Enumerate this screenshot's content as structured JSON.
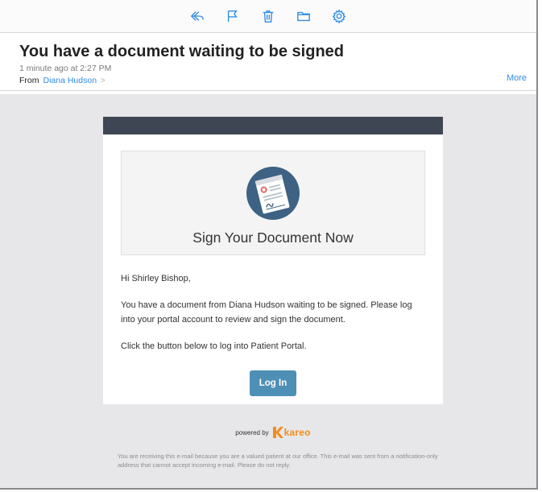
{
  "toolbar": {
    "icons": [
      "reply-icon",
      "flag-icon",
      "trash-icon",
      "folder-icon",
      "gear-icon"
    ]
  },
  "header": {
    "subject": "You have a document waiting to be signed",
    "time": "1 minute ago at 2:27 PM",
    "from_label": "From",
    "sender": "Diana Hudson",
    "more_label": "More"
  },
  "email": {
    "hero_title": "Sign Your Document Now",
    "greeting": "Hi Shirley Bishop,",
    "paragraph1": "You have a document from Diana Hudson waiting to be signed. Please log into your portal account to review and sign the document.",
    "paragraph2": "Click the button below to log into Patient Portal.",
    "button_label": "Log In",
    "powered_by": "powered by",
    "brand": "kareo",
    "footer": "You are receiving this e-mail because you are a valued patient at our office. This e-mail was sent from a notification-only address that cannot accept incoming e-mail. Please do not reply."
  },
  "colors": {
    "accent": "#2f8ce6",
    "header_bar": "#3f4653",
    "button": "#4e8fb5",
    "brand": "#f28c1e",
    "body_bg": "#e7e7e9"
  }
}
